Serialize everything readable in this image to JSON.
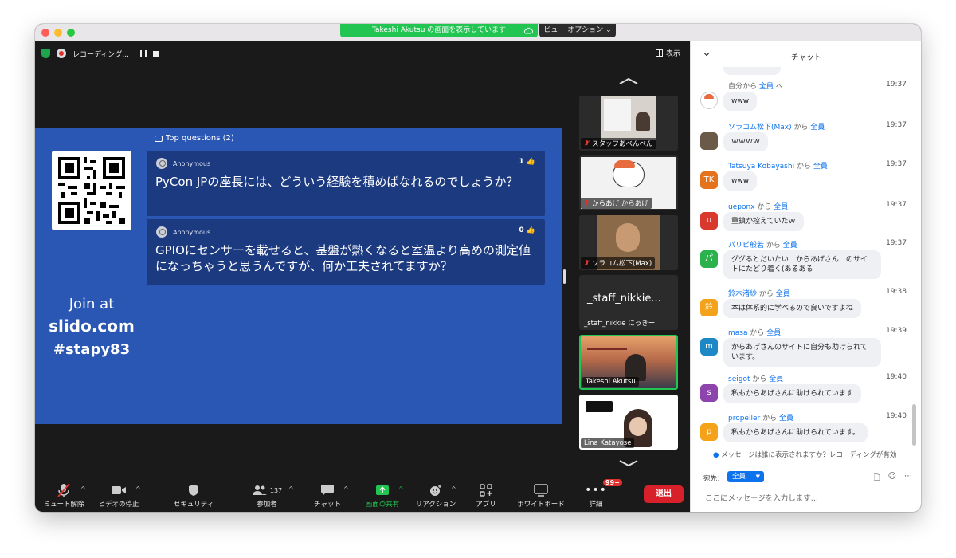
{
  "window": {
    "share_banner": "Takeshi Akutsu の画面を表示しています",
    "view_options": "ビュー オプション ⌄"
  },
  "topbar": {
    "recording_label": "レコーディング...",
    "view_label": "表示"
  },
  "slide": {
    "join_line1": "Join at",
    "join_line2": "slido.com",
    "join_line3": "#stapy83",
    "top_questions": "Top questions (2)",
    "questions": [
      {
        "author": "Anonymous",
        "likes": "1",
        "text": "PyCon JPの座長には、どういう経験を積めばなれるのでしょうか？"
      },
      {
        "author": "Anonymous",
        "likes": "0",
        "text": "GPIOにセンサーを載せると、基盤が熱くなると室温より高めの測定値になっちゃうと思うんですが、何か工夫されてますか？"
      }
    ]
  },
  "participants": [
    {
      "name": "スタッフあべんべん",
      "muted": true
    },
    {
      "name": "からあげ からあげ",
      "muted": true
    },
    {
      "name": "ソラコム松下(Max)",
      "muted": true
    },
    {
      "name": "_staff_nikkie にっきー",
      "big_name": "_staff_nikkie...",
      "muted": false
    },
    {
      "name": "Takeshi Akutsu",
      "muted": false
    },
    {
      "name": "Lina Katayose",
      "muted": false
    }
  ],
  "toolbar": {
    "mute": "ミュート解除",
    "video": "ビデオの停止",
    "security": "セキュリティ",
    "participants": "参加者",
    "participants_count": "137",
    "chat": "チャット",
    "share": "画面の共有",
    "reaction": "リアクション",
    "apps": "アプリ",
    "whiteboard": "ホワイトボード",
    "more": "詳細",
    "more_badge": "99+",
    "leave": "退出"
  },
  "chat": {
    "title": "チャット",
    "messages": [
      {
        "sender": "自分から",
        "to": "全員",
        "suffix": "へ",
        "time": "19:37",
        "text": "www",
        "avatar": "",
        "avatar_color": "#ffffff"
      },
      {
        "sender": "ソラコム松下(Max)",
        "from": "から",
        "to": "全員",
        "time": "19:37",
        "text": "ｗｗｗｗ",
        "avatar": "",
        "avatar_color": "#6b5a48"
      },
      {
        "sender": "Tatsuya Kobayashi",
        "from": "から",
        "to": "全員",
        "time": "19:37",
        "text": "www",
        "avatar": "TK",
        "avatar_color": "#e4731e"
      },
      {
        "sender": "ueponx",
        "from": "から",
        "to": "全員",
        "time": "19:37",
        "text": "重鎮か控えていたｗ",
        "avatar": "u",
        "avatar_color": "#d9382c"
      },
      {
        "sender": "パリピ般若",
        "from": "から",
        "to": "全員",
        "time": "19:37",
        "text": "ググるとだいたい　からあげさん　のサイトにたどり着く(あるある",
        "avatar": "パ",
        "avatar_color": "#2bb24c"
      },
      {
        "sender": "鈴木渚紗",
        "from": "から",
        "to": "全員",
        "time": "19:38",
        "text": "本は体系的に学べるので良いですよね",
        "avatar": "鈴",
        "avatar_color": "#f5a21b"
      },
      {
        "sender": "masa",
        "from": "から",
        "to": "全員",
        "time": "19:39",
        "text": "からあげさんのサイトに自分も助けられています。",
        "avatar": "m",
        "avatar_color": "#1e88c7"
      },
      {
        "sender": "seigot",
        "from": "から",
        "to": "全員",
        "time": "19:40",
        "text": "私もからあげさんに助けられています",
        "avatar": "s",
        "avatar_color": "#8e44ad"
      },
      {
        "sender": "propeller",
        "from": "から",
        "to": "全員",
        "time": "19:40",
        "text": "私もからあげさんに助けられています。",
        "avatar": "p",
        "avatar_color": "#f5a21b"
      }
    ],
    "notice": "メッセージは誰に表示されますか？レコーディングが有効",
    "to_label": "宛先：",
    "to_value": "全員",
    "input_placeholder": "ここにメッセージを入力します..."
  }
}
